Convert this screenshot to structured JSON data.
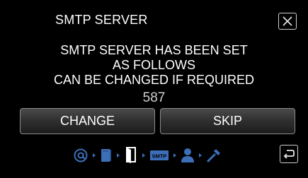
{
  "header": {
    "title": "SMTP SERVER"
  },
  "message": {
    "lines": [
      "SMTP SERVER HAS BEEN SET",
      "AS FOLLOWS",
      "CAN BE CHANGED IF REQUIRED"
    ],
    "port": "587"
  },
  "buttons": {
    "change": "CHANGE",
    "skip": "SKIP"
  },
  "steps": {
    "icons": [
      "at-sign-icon",
      "notebook-icon",
      "open-book-icon",
      "smtp-icon",
      "user-icon",
      "tools-icon"
    ],
    "active_index": 2,
    "smtp_label": "SMTP"
  },
  "colors": {
    "background": "#000000",
    "step_inactive": "#3c6fb8",
    "step_active": "#ffffff"
  }
}
